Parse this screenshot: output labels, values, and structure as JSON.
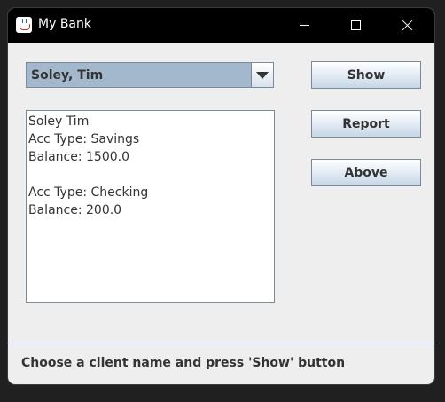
{
  "window": {
    "title": "My Bank",
    "icon": "java-cup-icon"
  },
  "title_buttons": {
    "minimize_icon": "minimize-icon",
    "maximize_icon": "maximize-icon",
    "close_icon": "close-icon"
  },
  "client_select": {
    "selected": "Soley, Tim",
    "arrow_icon": "chevron-down-icon"
  },
  "output": {
    "lines": [
      "Soley Tim",
      "Acc Type: Savings",
      "Balance: 1500.0",
      "",
      "Acc Type: Checking",
      "Balance: 200.0"
    ]
  },
  "buttons": {
    "show_label": "Show",
    "report_label": "Report",
    "above_label": "Above"
  },
  "status_bar": {
    "text": "Choose a client name and press 'Show' button"
  },
  "colors": {
    "titlebar": "#000000",
    "window_bg": "#eeeeee",
    "combo_bg": "#a3b8cc",
    "border": "#7a8a99",
    "divider": "#7a94c4",
    "text": "#333333"
  }
}
